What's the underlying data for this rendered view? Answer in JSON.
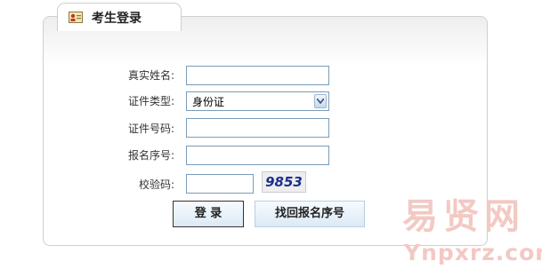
{
  "login": {
    "title": "考生登录",
    "fields": {
      "name_label": "真实姓名:",
      "id_type_label": "证件类型:",
      "id_type_value": "身份证",
      "id_number_label": "证件号码:",
      "reg_number_label": "报名序号:",
      "captcha_label": "校验码:",
      "captcha_code": "9853"
    },
    "buttons": {
      "login": "登 录",
      "find_reg_number": "找回报名序号"
    }
  },
  "watermark": {
    "cn": "易贤网",
    "en": "Ynpxrz.com"
  },
  "colors": {
    "input_border": "#7a9cb8",
    "watermark": "#f3c9c3",
    "captcha_text": "#1a2f8f"
  }
}
